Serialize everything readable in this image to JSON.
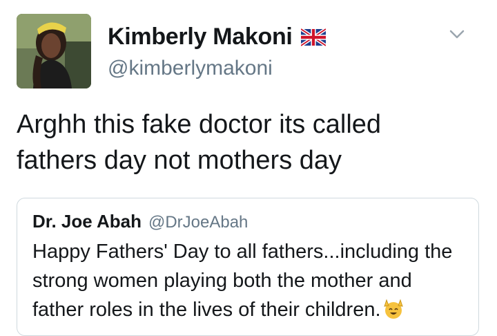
{
  "author": {
    "display_name": "Kimberly Makoni",
    "handle": "@kimberlymakoni",
    "flag_icon": "uk-flag-icon"
  },
  "tweet": {
    "text_line1": "Arghh this fake doctor its called",
    "text_line2": "fathers day not mothers day"
  },
  "quoted": {
    "display_name": "Dr. Joe Abah",
    "handle": "@DrJoeAbah",
    "text_line1": "Happy Fathers' Day to all fathers...including the",
    "text_line2": "strong women playing both the mother and",
    "text_line3": "father roles in the lives of their children.",
    "emoji_icon": "raising-hands-emoji-icon"
  },
  "colors": {
    "text": "#14171a",
    "secondary": "#657786",
    "border": "#cfd9de"
  }
}
